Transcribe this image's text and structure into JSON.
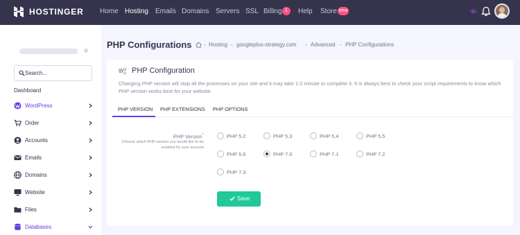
{
  "topbar": {
    "brand": "HOSTINGER",
    "nav": [
      "Home",
      "Hosting",
      "Emails",
      "Domains",
      "Servers",
      "SSL",
      "Billing",
      "Help",
      "Store"
    ],
    "active_nav": "Hosting",
    "billing_badge": "1",
    "store_badge": "new"
  },
  "sidebar": {
    "search_placeholder": "Search...",
    "section": "Dashboard",
    "items": [
      {
        "label": "WordPress",
        "icon": "wordpress-icon"
      },
      {
        "label": "Order",
        "icon": "cart-icon"
      },
      {
        "label": "Accounts",
        "icon": "accounts-icon"
      },
      {
        "label": "Emails",
        "icon": "mail-icon"
      },
      {
        "label": "Domains",
        "icon": "globe-icon"
      },
      {
        "label": "Website",
        "icon": "monitor-icon"
      },
      {
        "label": "Files",
        "icon": "folder-icon"
      },
      {
        "label": "Databases",
        "icon": "database-icon"
      }
    ]
  },
  "header": {
    "title": "PHP Configurations",
    "breadcrumb": [
      "Hosting",
      "googleplus-strategy.com",
      "Advanced",
      "PHP Configurations"
    ]
  },
  "card": {
    "title": "PHP Configuration",
    "description": "Changing PHP version will stop all the processes on your site and it may take 1-2 minute to complete it. It is always best to check your script requirements to know which PHP version works best for your website.",
    "tabs": [
      "PHP VERSION",
      "PHP EXTENSIONS",
      "PHP OPTIONS"
    ],
    "active_tab": "PHP VERSION",
    "field_label": "PHP Version",
    "field_required_mark": "*",
    "field_help": "Choose which PHP version you would like to be enabled for your account",
    "versions": [
      "PHP 5.2",
      "PHP 5.3",
      "PHP 5.4",
      "PHP 5.5",
      "PHP 5.6",
      "PHP 7.0",
      "PHP 7.1",
      "PHP 7.2",
      "PHP 7.3"
    ],
    "selected_version": "PHP 7.0",
    "save_label": "Save"
  },
  "colors": {
    "topbar": "#36344d",
    "accent": "#673de6",
    "save": "#20c997",
    "badge": "#fc5185",
    "background": "#f4f5ff"
  }
}
